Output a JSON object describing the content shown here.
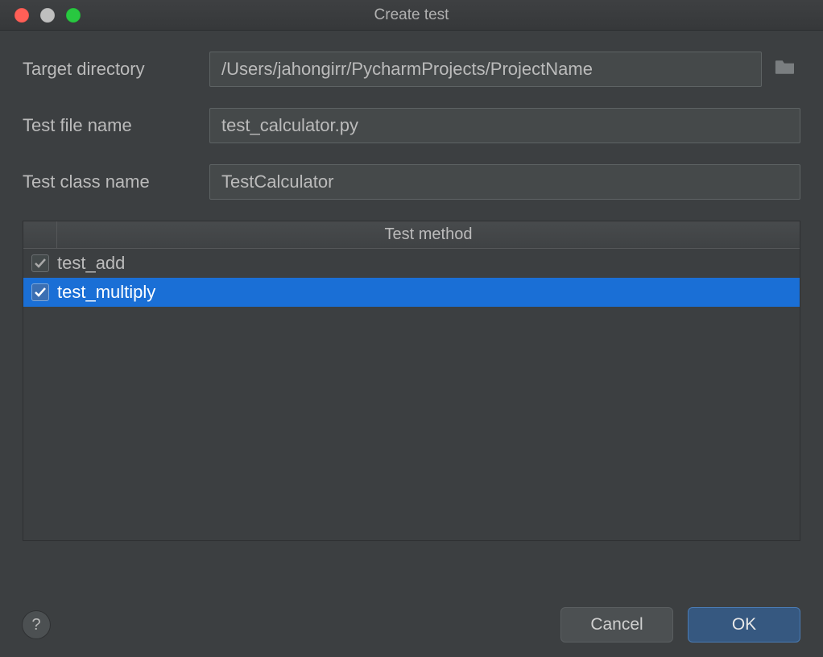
{
  "window": {
    "title": "Create test"
  },
  "form": {
    "target_directory_label": "Target directory",
    "target_directory_value": "/Users/jahongirr/PycharmProjects/ProjectName",
    "file_name_label": "Test file name",
    "file_name_value": "test_calculator.py",
    "class_name_label": "Test class name",
    "class_name_value": "TestCalculator"
  },
  "table": {
    "header": "Test method",
    "methods": [
      {
        "name": "test_add",
        "checked": true,
        "selected": false
      },
      {
        "name": "test_multiply",
        "checked": true,
        "selected": true
      }
    ]
  },
  "buttons": {
    "help": "?",
    "cancel": "Cancel",
    "ok": "OK"
  },
  "colors": {
    "selection": "#1a6fd6",
    "bg": "#3c3f41",
    "input_bg": "#45494a",
    "ok_bg": "#365880"
  }
}
